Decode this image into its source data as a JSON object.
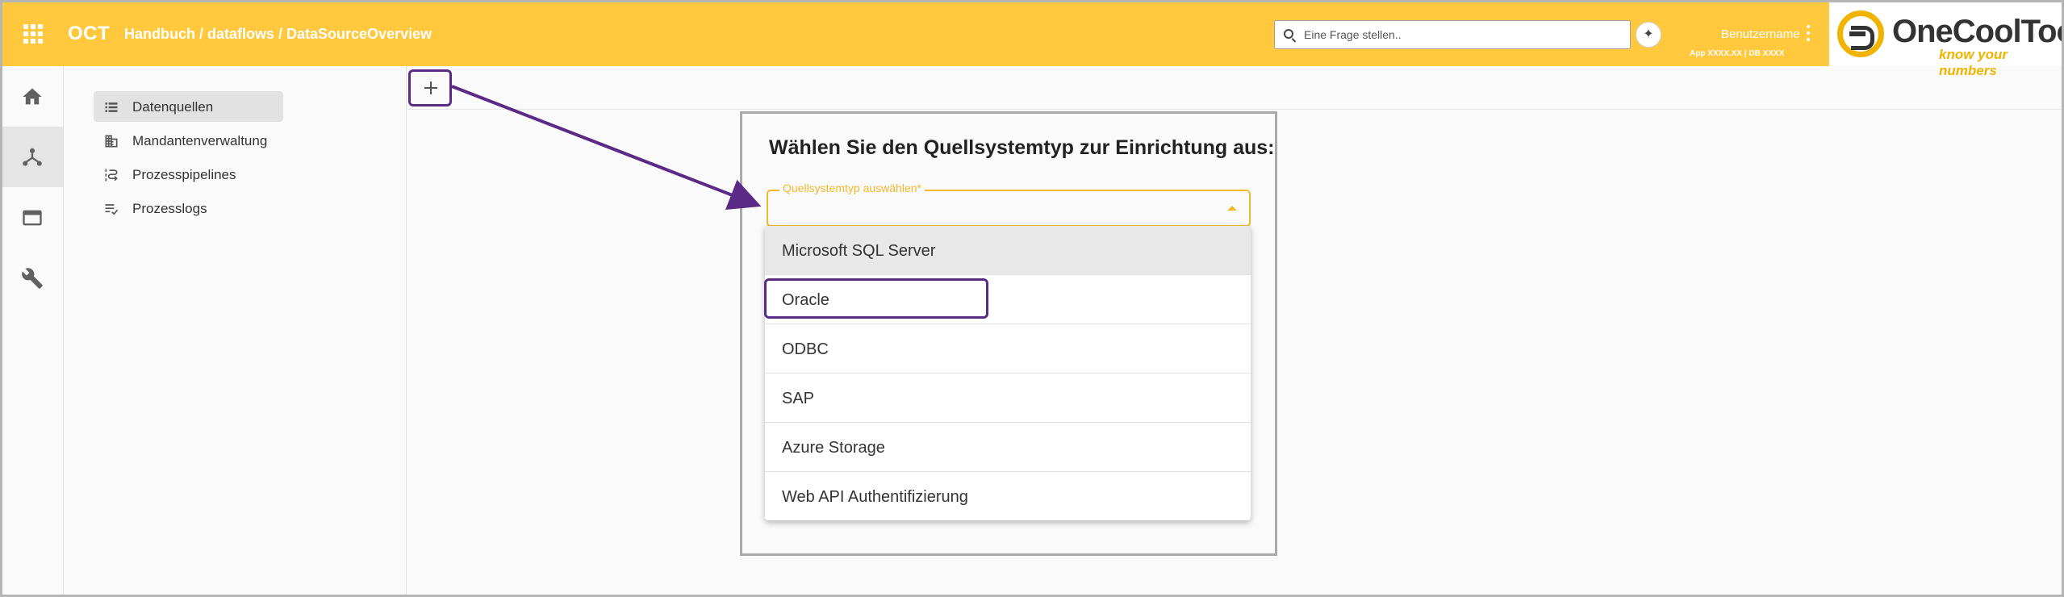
{
  "header": {
    "app_title": "OCT",
    "breadcrumb": "Handbuch / dataflows / DataSourceOverview",
    "search_placeholder": "Eine Frage stellen..",
    "username": "Benutzername",
    "version": "App XXXX.XX | DB XXXX",
    "logo_text": "OneCoolTool",
    "logo_tagline": "know your numbers"
  },
  "rail": {
    "items": [
      {
        "icon": "home-icon"
      },
      {
        "icon": "dataflow-icon",
        "active": true
      },
      {
        "icon": "browser-window-icon"
      },
      {
        "icon": "wrench-icon"
      }
    ]
  },
  "subnav": {
    "items": [
      {
        "label": "Datenquellen",
        "icon": "list-icon",
        "active": true
      },
      {
        "label": "Mandantenverwaltung",
        "icon": "building-icon"
      },
      {
        "label": "Prozesspipelines",
        "icon": "pipeline-icon"
      },
      {
        "label": "Prozesslogs",
        "icon": "checklist-icon"
      }
    ]
  },
  "dialog": {
    "title": "Wählen Sie den Quellsystemtyp zur Einrichtung aus:",
    "select_label": "Quellsystemtyp auswählen*",
    "options": [
      "Microsoft SQL Server",
      "Oracle",
      "ODBC",
      "SAP",
      "Azure Storage",
      "Web API Authentifizierung"
    ]
  },
  "colors": {
    "brand_yellow": "#ffc83d",
    "highlight_purple": "#5b2a86",
    "field_accent": "#f2b82c"
  }
}
